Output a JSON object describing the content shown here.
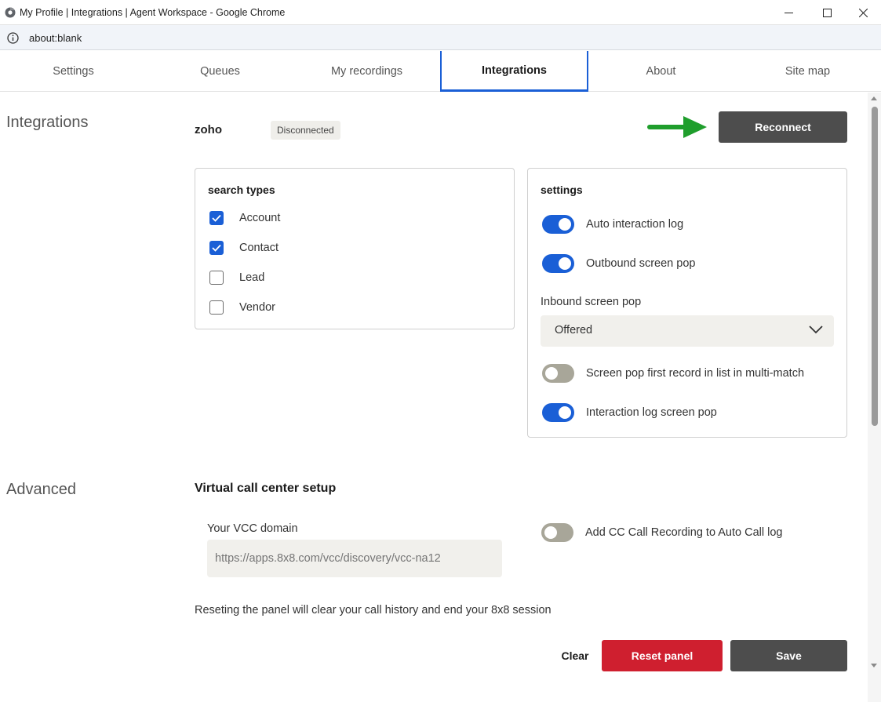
{
  "window": {
    "title": "My Profile | Integrations | Agent Workspace - Google Chrome",
    "url": "about:blank"
  },
  "tabs": [
    {
      "label": "Settings"
    },
    {
      "label": "Queues"
    },
    {
      "label": "My recordings"
    },
    {
      "label": "Integrations",
      "active": true
    },
    {
      "label": "About"
    },
    {
      "label": "Site map"
    }
  ],
  "integrations": {
    "heading": "Integrations",
    "name": "zoho",
    "status": "Disconnected",
    "reconnect_label": "Reconnect",
    "arrow_color": "#1f9e2c"
  },
  "search_types": {
    "title": "search types",
    "items": [
      {
        "label": "Account",
        "checked": true
      },
      {
        "label": "Contact",
        "checked": true
      },
      {
        "label": "Lead",
        "checked": false
      },
      {
        "label": "Vendor",
        "checked": false
      }
    ]
  },
  "settings": {
    "title": "settings",
    "auto_interaction_log": {
      "label": "Auto interaction log",
      "on": true
    },
    "outbound_screen_pop": {
      "label": "Outbound screen pop",
      "on": true
    },
    "inbound_label": "Inbound screen pop",
    "inbound_value": "Offered",
    "multi_match": {
      "label": "Screen pop first record in list in multi-match",
      "on": false
    },
    "interaction_log_pop": {
      "label": "Interaction log screen pop",
      "on": true
    }
  },
  "advanced": {
    "heading": "Advanced",
    "vcc_heading": "Virtual call center setup",
    "vcc_domain_label": "Your VCC domain",
    "vcc_domain_placeholder": "https://apps.8x8.com/vcc/discovery/vcc-na12",
    "cc_recording": {
      "label": "Add CC Call Recording to Auto Call log",
      "on": false
    },
    "reset_note": "Reseting the panel will clear your call history and end your 8x8 session"
  },
  "actions": {
    "clear_label": "Clear",
    "reset_label": "Reset panel",
    "save_label": "Save"
  },
  "colors": {
    "accent": "#1a5fd6",
    "danger": "#cf1f2f",
    "dark_button": "#4d4d4d"
  }
}
